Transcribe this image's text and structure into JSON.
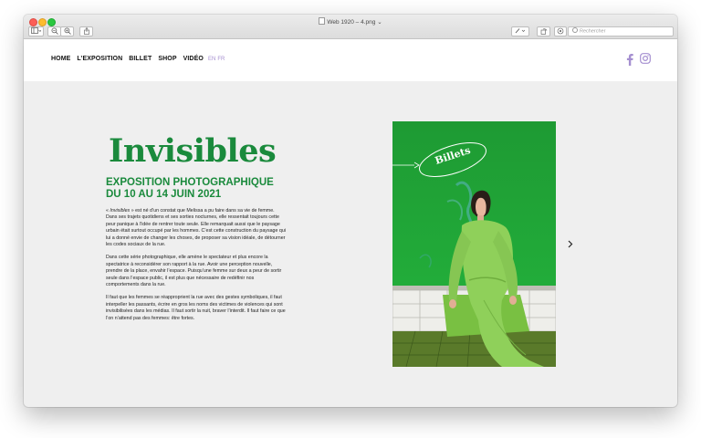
{
  "window": {
    "title": "Web 1920 – 4.png",
    "title_chevron": "⌄",
    "search_placeholder": "Rechercher"
  },
  "nav": {
    "items": [
      {
        "label": "HOME"
      },
      {
        "label": "L’EXPOSITION"
      },
      {
        "label": "BILLET"
      },
      {
        "label": "SHOP"
      },
      {
        "label": "VIDÉO"
      }
    ],
    "lang": {
      "en": "EN",
      "fr": "FR"
    }
  },
  "social": {
    "facebook": "facebook-icon",
    "instagram": "instagram-icon"
  },
  "hero": {
    "title": "Invisibles",
    "subtitle_line1": "EXPOSITION PHOTOGRAPHIQUE",
    "subtitle_line2": "DU 10 AU 14 JUIN 2021",
    "p1_prefix": "« ",
    "p1_italic": "Invisibles",
    "p1_rest": " » est né d’un constat que Melissa a pu faire dans sa vie de femme. Dans ses trajets quotidiens et ses sorties nocturnes, elle ressentait toujours cette peur panique à l’idée de rentrer toute seule. Elle remarquait aussi que le paysage urbain était surtout occupé par les hommes. C’est cette construction du paysage qui lui a donné envie de changer les choses, de proposer sa vision idéale, de détourner les codes sociaux de la rue.",
    "p2": "Dans cette série photographique, elle amène le spectateur et plus encore la spectatrice à reconsidérer son rapport à la rue. Avoir une perception nouvelle, prendre de la place, envahir l’espace. Puisqu’une femme sur deux a peur de sortir seule dans l’espace public, il est plus que nécessaire de redéfinir nos comportements dans la rue.",
    "p3": "Il faut que les femmes se réapproprient la rue avec des gestes symboliques, il faut interpeller les passants, écrire en gros les noms des victimes de violences qui sont invisibilisées dans les médias. Il faut sortir la nuit, braver l’interdit. Il faut faire ce que l’on n’attend pas des femmes: être fortes."
  },
  "photo": {
    "badge_label": "Billets"
  },
  "colors": {
    "brand_green": "#1a8a3c",
    "photo_green": "#1fa536",
    "suit_green": "#8fd05a",
    "lang_purple": "#a58fd0",
    "page_bg": "#efefef"
  }
}
